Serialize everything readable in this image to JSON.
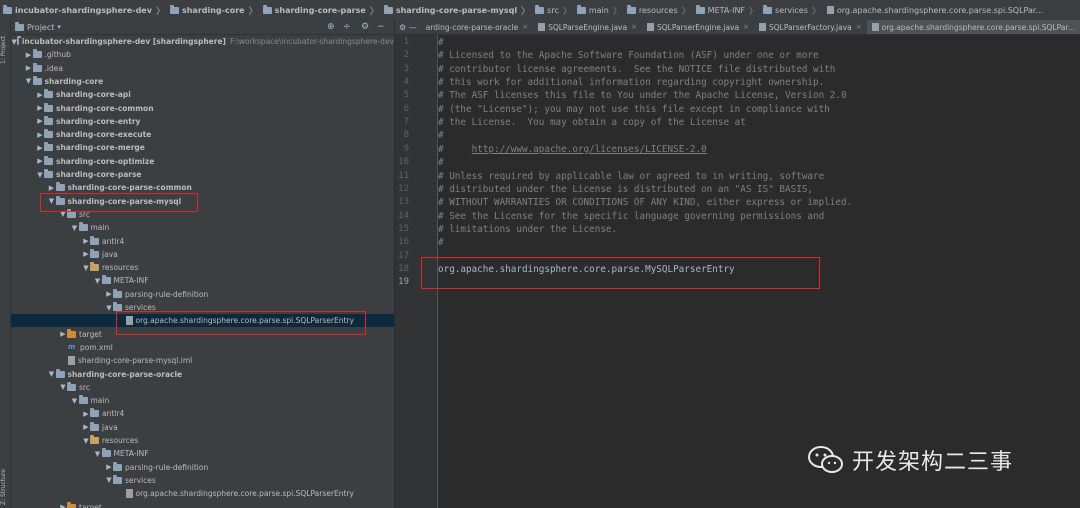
{
  "breadcrumbs": [
    {
      "label": "incubator-shardingsphere-dev",
      "bold": true,
      "icon": "folder-icon"
    },
    {
      "label": "sharding-core",
      "bold": true,
      "icon": "folder-icon"
    },
    {
      "label": "sharding-core-parse",
      "bold": true,
      "icon": "folder-icon"
    },
    {
      "label": "sharding-core-parse-mysql",
      "bold": true,
      "icon": "folder-icon"
    },
    {
      "label": "src",
      "bold": false,
      "icon": "folder-icon"
    },
    {
      "label": "main",
      "bold": false,
      "icon": "folder-icon"
    },
    {
      "label": "resources",
      "bold": false,
      "icon": "folder-icon"
    },
    {
      "label": "META-INF",
      "bold": false,
      "icon": "folder-icon"
    },
    {
      "label": "services",
      "bold": false,
      "icon": "folder-icon"
    },
    {
      "label": "org.apache.shardingsphere.core.parse.spi.SQLPar...",
      "bold": false,
      "icon": "file-icon"
    }
  ],
  "left_strip": {
    "project_tab": "1: Project",
    "structure_tab": "Z: Structure"
  },
  "project_panel": {
    "title": "Project",
    "dropdown_icon": "chevron-down-icon",
    "toolbar_icons": [
      "target-icon",
      "collapse-icon",
      "gear-icon",
      "hide-icon"
    ],
    "tree": [
      {
        "depth": 0,
        "arrow": "▼",
        "icon": "module",
        "label": "incubator-shardingsphere-dev [shardingsphere]",
        "path": "F:\\workspace\\incubator-shardingsphere-dev",
        "bold": true
      },
      {
        "depth": 1,
        "arrow": "▶",
        "icon": "folder",
        "label": ".github"
      },
      {
        "depth": 1,
        "arrow": "▶",
        "icon": "folder",
        "label": ".idea"
      },
      {
        "depth": 1,
        "arrow": "▼",
        "icon": "module",
        "label": "sharding-core",
        "bold": true
      },
      {
        "depth": 2,
        "arrow": "▶",
        "icon": "module",
        "label": "sharding-core-api",
        "bold": true
      },
      {
        "depth": 2,
        "arrow": "▶",
        "icon": "module",
        "label": "sharding-core-common",
        "bold": true
      },
      {
        "depth": 2,
        "arrow": "▶",
        "icon": "module",
        "label": "sharding-core-entry",
        "bold": true
      },
      {
        "depth": 2,
        "arrow": "▶",
        "icon": "module",
        "label": "sharding-core-execute",
        "bold": true
      },
      {
        "depth": 2,
        "arrow": "▶",
        "icon": "module",
        "label": "sharding-core-merge",
        "bold": true
      },
      {
        "depth": 2,
        "arrow": "▶",
        "icon": "module",
        "label": "sharding-core-optimize",
        "bold": true
      },
      {
        "depth": 2,
        "arrow": "▼",
        "icon": "module",
        "label": "sharding-core-parse",
        "bold": true
      },
      {
        "depth": 3,
        "arrow": "▶",
        "icon": "module",
        "label": "sharding-core-parse-common",
        "bold": true
      },
      {
        "depth": 3,
        "arrow": "▼",
        "icon": "module",
        "label": "sharding-core-parse-mysql",
        "bold": true
      },
      {
        "depth": 4,
        "arrow": "▼",
        "icon": "folder",
        "label": "src"
      },
      {
        "depth": 5,
        "arrow": "▼",
        "icon": "folder",
        "label": "main"
      },
      {
        "depth": 6,
        "arrow": "▶",
        "icon": "folder",
        "label": "antlr4"
      },
      {
        "depth": 6,
        "arrow": "▶",
        "icon": "folder",
        "label": "java"
      },
      {
        "depth": 6,
        "arrow": "▼",
        "icon": "folder-tan",
        "label": "resources"
      },
      {
        "depth": 7,
        "arrow": "▼",
        "icon": "folder",
        "label": "META-INF"
      },
      {
        "depth": 8,
        "arrow": "▶",
        "icon": "folder",
        "label": "parsing-rule-definition"
      },
      {
        "depth": 8,
        "arrow": "▼",
        "icon": "folder",
        "label": "services"
      },
      {
        "depth": 9,
        "arrow": "",
        "icon": "file",
        "label": "org.apache.shardingsphere.core.parse.spi.SQLParserEntry",
        "selected": true
      },
      {
        "depth": 4,
        "arrow": "▶",
        "icon": "folder-orange",
        "label": "target"
      },
      {
        "depth": 4,
        "arrow": "",
        "icon": "m",
        "label": "pom.xml"
      },
      {
        "depth": 4,
        "arrow": "",
        "icon": "file",
        "label": "sharding-core-parse-mysql.iml"
      },
      {
        "depth": 3,
        "arrow": "▼",
        "icon": "module",
        "label": "sharding-core-parse-oracle",
        "bold": true
      },
      {
        "depth": 4,
        "arrow": "▼",
        "icon": "folder",
        "label": "src"
      },
      {
        "depth": 5,
        "arrow": "▼",
        "icon": "folder",
        "label": "main"
      },
      {
        "depth": 6,
        "arrow": "▶",
        "icon": "folder",
        "label": "antlr4"
      },
      {
        "depth": 6,
        "arrow": "▶",
        "icon": "folder",
        "label": "java"
      },
      {
        "depth": 6,
        "arrow": "▼",
        "icon": "folder-tan",
        "label": "resources"
      },
      {
        "depth": 7,
        "arrow": "▼",
        "icon": "folder",
        "label": "META-INF"
      },
      {
        "depth": 8,
        "arrow": "▶",
        "icon": "folder",
        "label": "parsing-rule-definition"
      },
      {
        "depth": 8,
        "arrow": "▼",
        "icon": "folder",
        "label": "services"
      },
      {
        "depth": 9,
        "arrow": "",
        "icon": "file",
        "label": "org.apache.shardingsphere.core.parse.spi.SQLParserEntry"
      },
      {
        "depth": 4,
        "arrow": "▶",
        "icon": "folder-orange",
        "label": "target"
      }
    ]
  },
  "tabs": [
    {
      "label": "arding-core-parse-oracle",
      "active": false
    },
    {
      "label": "SQLParseEngine.java",
      "active": false
    },
    {
      "label": "SQLParserEngine.java",
      "active": false
    },
    {
      "label": "SQLParserFactory.java",
      "active": false
    },
    {
      "label": "org.apache.shardingsphere.core.parse.spi.SQLPar...",
      "active": true
    }
  ],
  "editor": {
    "lines": [
      {
        "n": "1",
        "text": "#"
      },
      {
        "n": "2",
        "text": "# Licensed to the Apache Software Foundation (ASF) under one or more"
      },
      {
        "n": "3",
        "text": "# contributor license agreements.  See the NOTICE file distributed with"
      },
      {
        "n": "4",
        "text": "# this work for additional information regarding copyright ownership."
      },
      {
        "n": "5",
        "text": "# The ASF licenses this file to You under the Apache License, Version 2.0"
      },
      {
        "n": "6",
        "text": "# (the \"License\"); you may not use this file except in compliance with"
      },
      {
        "n": "7",
        "text": "# the License.  You may obtain a copy of the License at"
      },
      {
        "n": "8",
        "text": "#"
      },
      {
        "n": "9",
        "text": "#     ",
        "link": "http://www.apache.org/licenses/LICENSE-2.0"
      },
      {
        "n": "10",
        "text": "#"
      },
      {
        "n": "11",
        "text": "# Unless required by applicable law or agreed to in writing, software"
      },
      {
        "n": "12",
        "text": "# distributed under the License is distributed on an \"AS IS\" BASIS,"
      },
      {
        "n": "13",
        "text": "# WITHOUT WARRANTIES OR CONDITIONS OF ANY KIND, either express or implied."
      },
      {
        "n": "14",
        "text": "# See the License for the specific language governing permissions and"
      },
      {
        "n": "15",
        "text": "# limitations under the License."
      },
      {
        "n": "16",
        "text": "#"
      },
      {
        "n": "17",
        "text": ""
      },
      {
        "n": "18",
        "text": "org.apache.shardingsphere.core.parse.MySQLParserEntry",
        "plain": true
      },
      {
        "n": "19",
        "text": ""
      }
    ]
  },
  "watermark": {
    "text": "开发架构二三事",
    "icon": "wechat-icon"
  },
  "colors": {
    "highlight_box": "#e0262a",
    "selection": "#0d293e",
    "editor_bg": "#2b2b2b",
    "panel_bg": "#3c3f41"
  }
}
